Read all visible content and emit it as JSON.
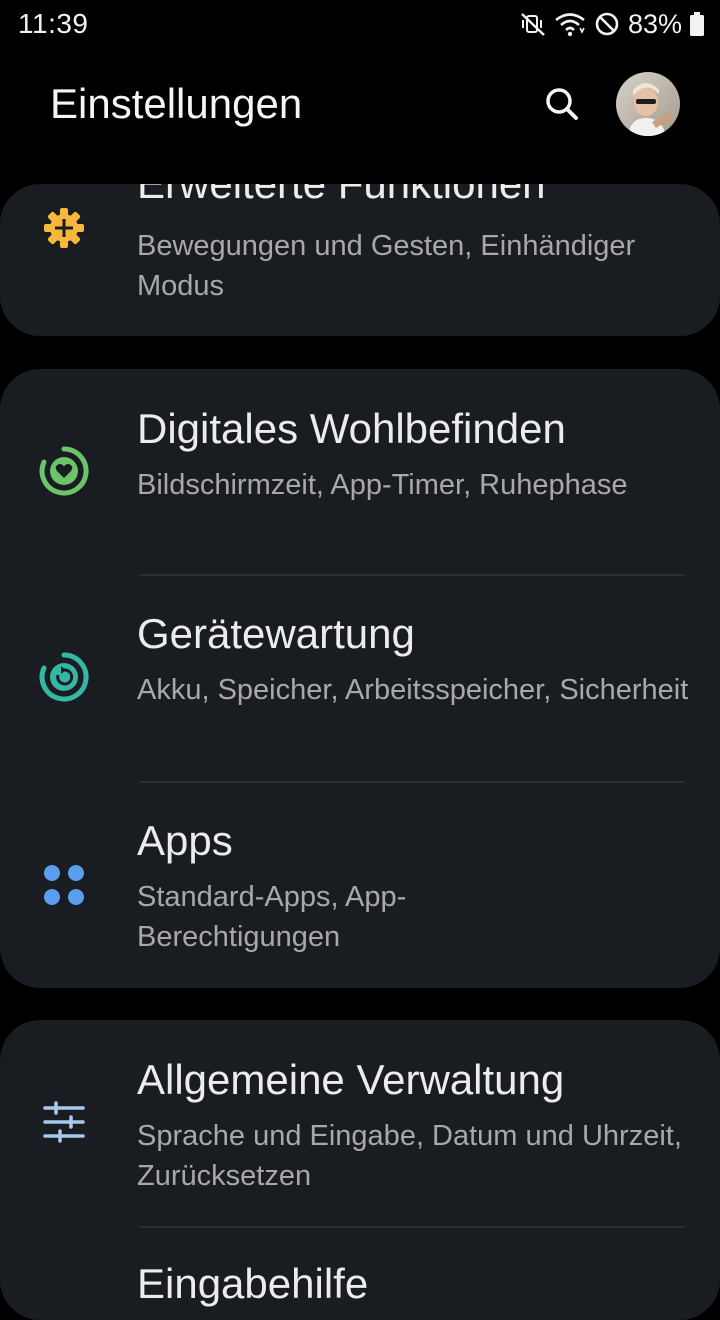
{
  "status_bar": {
    "time": "11:39",
    "battery_percent": "83%",
    "icons": [
      "mute-vibrate-icon",
      "wifi-icon",
      "do-not-disturb-icon",
      "battery-icon"
    ]
  },
  "header": {
    "title": "Einstellungen",
    "search_icon": "search-icon",
    "avatar_icon": "profile-avatar"
  },
  "settings": [
    {
      "title": "Erweiterte Funktionen",
      "subtitle": "Bewegungen und Gesten, Einhändiger Modus",
      "icon": "gear-plus-icon",
      "icon_color": "#f6b73c"
    },
    {
      "title": "Digitales Wohlbefinden",
      "subtitle": "Bildschirmzeit, App-Timer, Ruhephase",
      "icon": "wellbeing-heart-icon",
      "icon_color": "#6cc36a"
    },
    {
      "title": "Gerätewartung",
      "subtitle": "Akku, Speicher, Arbeitsspeicher, Sicherheit",
      "icon": "device-care-icon",
      "icon_color": "#34b7a4"
    },
    {
      "title": "Apps",
      "subtitle": "Standard-Apps, App-Berechtigungen",
      "icon": "apps-grid-icon",
      "icon_color": "#5b9ef0"
    },
    {
      "title": "Allgemeine Verwaltung",
      "subtitle": "Sprache und Eingabe, Datum und Uhrzeit, Zurücksetzen",
      "icon": "sliders-icon",
      "icon_color": "#a9c8f0"
    },
    {
      "title": "Eingabehilfe",
      "subtitle": "",
      "icon": "",
      "icon_color": ""
    }
  ],
  "colors": {
    "background": "#000000",
    "card": "#191c21",
    "title_text": "#ececec",
    "subtitle_text": "#a8a8a8"
  }
}
